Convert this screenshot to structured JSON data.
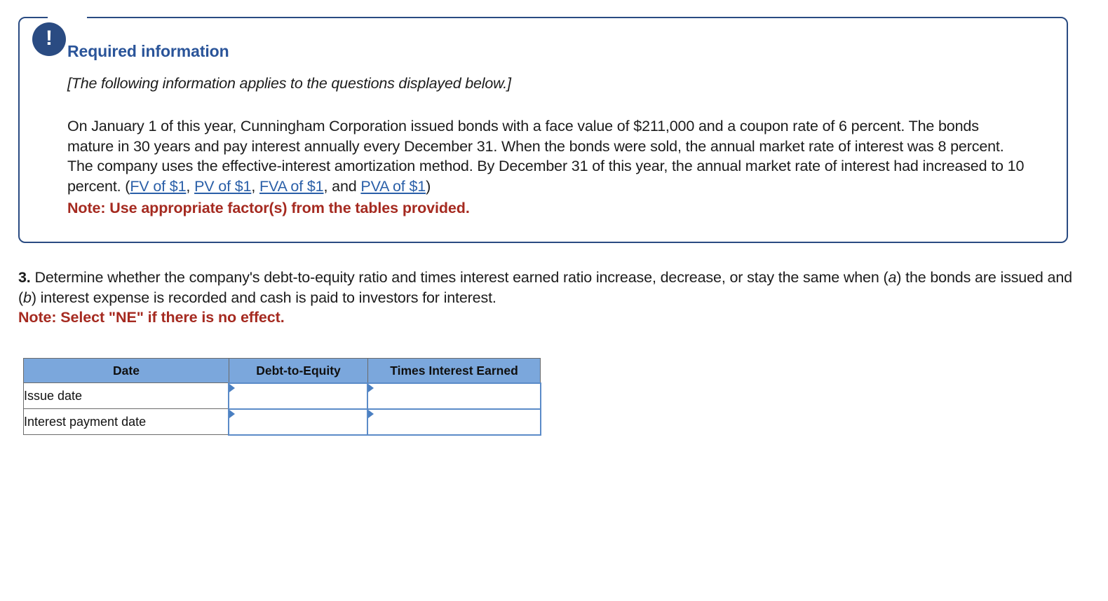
{
  "alert": {
    "icon": "exclamation-icon",
    "heading": "Required information",
    "applies_note": "[The following information applies to the questions displayed below.]",
    "scenario_part1": "On January 1 of this year, Cunningham Corporation issued bonds with a face value of $211,000 and a coupon rate of 6 percent. The bonds mature in 30 years and pay interest annually every December 31. When the bonds were sold, the annual market rate of interest was 8 percent. The company uses the effective-interest amortization method. By December 31 of this year, the annual market rate of interest had increased to 10 percent. (",
    "link_fv": "FV of $1",
    "sep1": ", ",
    "link_pv": "PV of $1",
    "sep2": ", ",
    "link_fva": "FVA of $1",
    "sep3": ", and ",
    "link_pva": "PVA of $1",
    "scenario_part2": ")",
    "note_red": "Note: Use appropriate factor(s) from the tables provided."
  },
  "question": {
    "number": "3.",
    "text_a": " Determine whether the company's debt-to-equity ratio and times interest earned ratio increase, decrease, or stay the same when (",
    "italic_a": "a",
    "text_b": ") the bonds are issued and (",
    "italic_b": "b",
    "text_c": ") interest expense is recorded and cash is paid to investors for interest.",
    "note_red": "Note: Select \"NE\" if there is no effect."
  },
  "table": {
    "headers": [
      "Date",
      "Debt-to-Equity",
      "Times Interest Earned"
    ],
    "rows": [
      {
        "label": "Issue date",
        "debt_to_equity": "",
        "times_interest_earned": ""
      },
      {
        "label": "Interest payment date",
        "debt_to_equity": "",
        "times_interest_earned": ""
      }
    ]
  },
  "colors": {
    "panel_border": "#2a4b82",
    "badge": "#2a4b82",
    "heading_blue": "#2a5499",
    "link_blue": "#2a5fa8",
    "note_red": "#a52a20",
    "table_header_blue": "#7ba7dc",
    "dropdown_border": "#5b8bc8"
  }
}
